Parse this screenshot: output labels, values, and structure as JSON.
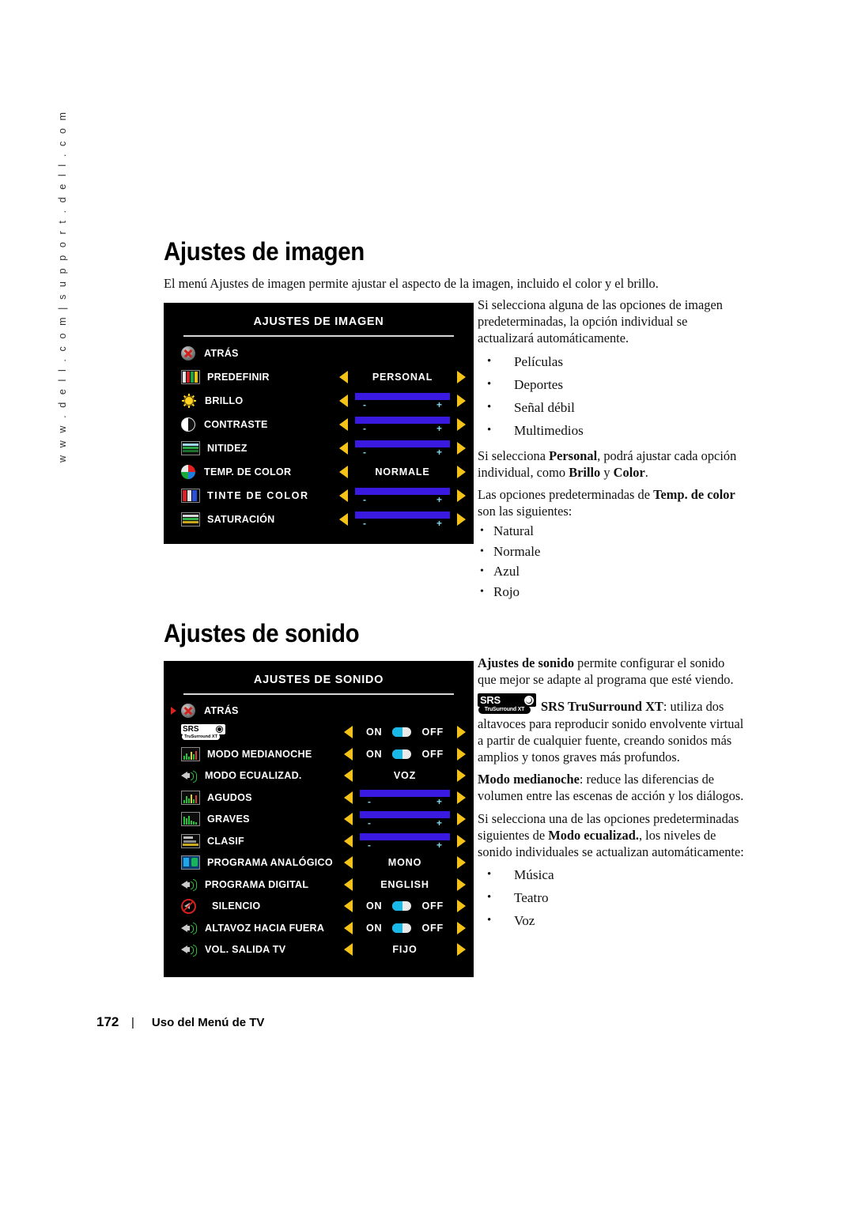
{
  "sidebar": {
    "url_text": "w w w . d e l l . c o m  |  s u p p o r t . d e l l . c o m"
  },
  "image_section": {
    "title": "Ajustes de imagen",
    "intro": "El menú Ajustes de imagen permite ajustar el aspecto de la imagen, incluido el color y el brillo.",
    "right_para_1": "Si selecciona alguna de las opciones de imagen predeterminadas, la opción individual se actualizará automáticamente.",
    "presets": [
      "Películas",
      "Deportes",
      "Señal débil",
      "Multimedios"
    ],
    "right_para_2_a": "Si selecciona ",
    "right_para_2_b": "Personal",
    "right_para_2_c": ", podrá ajustar cada opción individual, como ",
    "right_para_2_d": "Brillo",
    "right_para_2_e": " y ",
    "right_para_2_f": "Color",
    "right_para_2_g": ".",
    "right_para_3_a": "Las opciones predeterminadas de ",
    "right_para_3_b": "Temp. de color",
    "right_para_3_c": " son las siguientes:",
    "color_temps": [
      "Natural",
      "Normale",
      "Azul",
      "Rojo"
    ],
    "bullet": "•"
  },
  "osd_image": {
    "title": "AJUSTES DE IMAGEN",
    "rows": [
      {
        "label": "ATRÁS",
        "icon": "back-icon",
        "control": "none"
      },
      {
        "label": "PREDEFINIR",
        "icon": "preset-icon",
        "control": "value",
        "value": "PERSONAL"
      },
      {
        "label": "BRILLO",
        "icon": "brightness-icon",
        "control": "slider"
      },
      {
        "label": "CONTRASTE",
        "icon": "contrast-icon",
        "control": "slider"
      },
      {
        "label": "NITIDEZ",
        "icon": "sharpness-icon",
        "control": "slider"
      },
      {
        "label": "TEMP. DE COLOR",
        "icon": "color-wheel-icon",
        "control": "value",
        "value": "NORMALE"
      },
      {
        "label": "TINTE  DE  COLOR",
        "icon": "tint-icon",
        "control": "slider"
      },
      {
        "label": "SATURACIÓN",
        "icon": "saturation-icon",
        "control": "slider"
      }
    ],
    "slider_minus": "-",
    "slider_plus": "+"
  },
  "sound_section": {
    "title": "Ajustes de sonido",
    "right_para_1_a": "Ajustes de sonido",
    "right_para_1_b": " permite configurar el sonido que mejor se adapte al programa que esté viendo.",
    "srs_logo_main": "SRS",
    "srs_logo_sub": "TruSurround XT",
    "right_para_2_a": "SRS TruSurround XT",
    "right_para_2_b": ": utiliza dos altavoces para reproducir sonido envolvente virtual a partir de cualquier fuente, creando sonidos más amplios y tonos graves más profundos.",
    "right_para_3_a": "Modo medianoche",
    "right_para_3_b": ": reduce las diferencias de volumen entre las escenas de acción y los diálogos.",
    "right_para_4_a": "Si selecciona una de las opciones predeterminadas siguientes de ",
    "right_para_4_b": "Modo ecualizad.",
    "right_para_4_c": ", los niveles de sonido individuales se actualizan automáticamente:",
    "eq_presets": [
      "Música",
      "Teatro",
      "Voz"
    ],
    "bullet": "•"
  },
  "osd_sound": {
    "title": "AJUSTES DE SONIDO",
    "rows": [
      {
        "label": "ATRÁS",
        "icon": "back-icon",
        "control": "none",
        "pointer": true
      },
      {
        "label": "",
        "icon": "srs-icon",
        "control": "onoff",
        "on": "ON",
        "off": "OFF"
      },
      {
        "label": "MODO MEDIANOCHE",
        "icon": "eq-icon",
        "control": "onoff",
        "on": "ON",
        "off": "OFF"
      },
      {
        "label": "MODO ECUALIZAD.",
        "icon": "speaker-icon",
        "control": "value",
        "value": "VOZ"
      },
      {
        "label": "AGUDOS",
        "icon": "eq-icon",
        "control": "slider"
      },
      {
        "label": "GRAVES",
        "icon": "eq-icon",
        "control": "slider"
      },
      {
        "label": "CLASIF",
        "icon": "rating-icon",
        "control": "slider"
      },
      {
        "label": "PROGRAMA ANALÓGICO",
        "icon": "program-icon",
        "control": "value",
        "value": "MONO"
      },
      {
        "label": "PROGRAMA DIGITAL",
        "icon": "speaker-icon",
        "control": "value",
        "value": "ENGLISH"
      },
      {
        "label": "SILENCIO",
        "icon": "mute-icon",
        "control": "onoff",
        "on": "ON",
        "off": "OFF"
      },
      {
        "label": "ALTAVOZ HACIA FUERA",
        "icon": "speaker-icon",
        "control": "onoff",
        "on": "ON",
        "off": "OFF"
      },
      {
        "label": "VOL. SALIDA TV",
        "icon": "speaker-icon",
        "control": "value",
        "value": "FIJO"
      }
    ],
    "slider_minus": "-",
    "slider_plus": "+",
    "srs_logo_main": "SRS",
    "srs_logo_sub": "TruSurround XT"
  },
  "footer": {
    "page_number": "172",
    "separator": "|",
    "section": "Uso del Menú de TV"
  }
}
